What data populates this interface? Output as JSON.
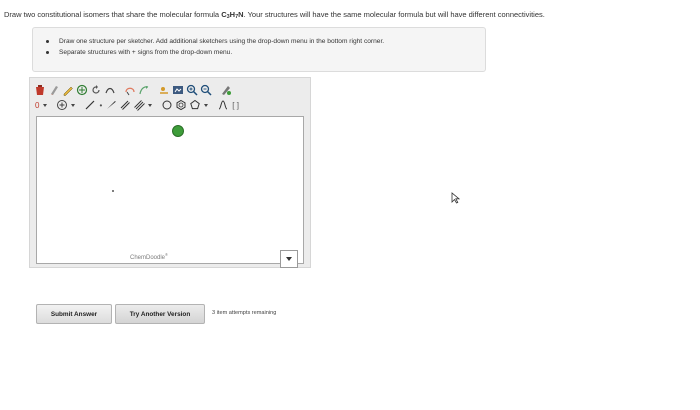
{
  "question": {
    "text_before": "Draw two constitutional isomers that share the molecular formula ",
    "formula_c": "C",
    "formula_c_sub": "3",
    "formula_h": "H",
    "formula_h_sub": "7",
    "formula_n": "N",
    "text_after": ". Your structures will have the same molecular formula but will have different connectivities."
  },
  "hints": [
    "Draw one structure per sketcher. Add additional sketchers using the drop-down menu in the bottom right corner.",
    "Separate structures with + signs from the drop-down menu."
  ],
  "sketcher": {
    "brand": "ChemDoodle",
    "brand_mark": "®",
    "toolbar_text_bracket": "[ ]",
    "toolbar_text_dot": "•",
    "atom_label": "0"
  },
  "buttons": {
    "submit": "Submit Answer",
    "another": "Try Another Version"
  },
  "attempts": "3 item attempts remaining",
  "colors": {
    "green_marker": "#3e9d3a",
    "toolbar_bg": "#ececec"
  }
}
